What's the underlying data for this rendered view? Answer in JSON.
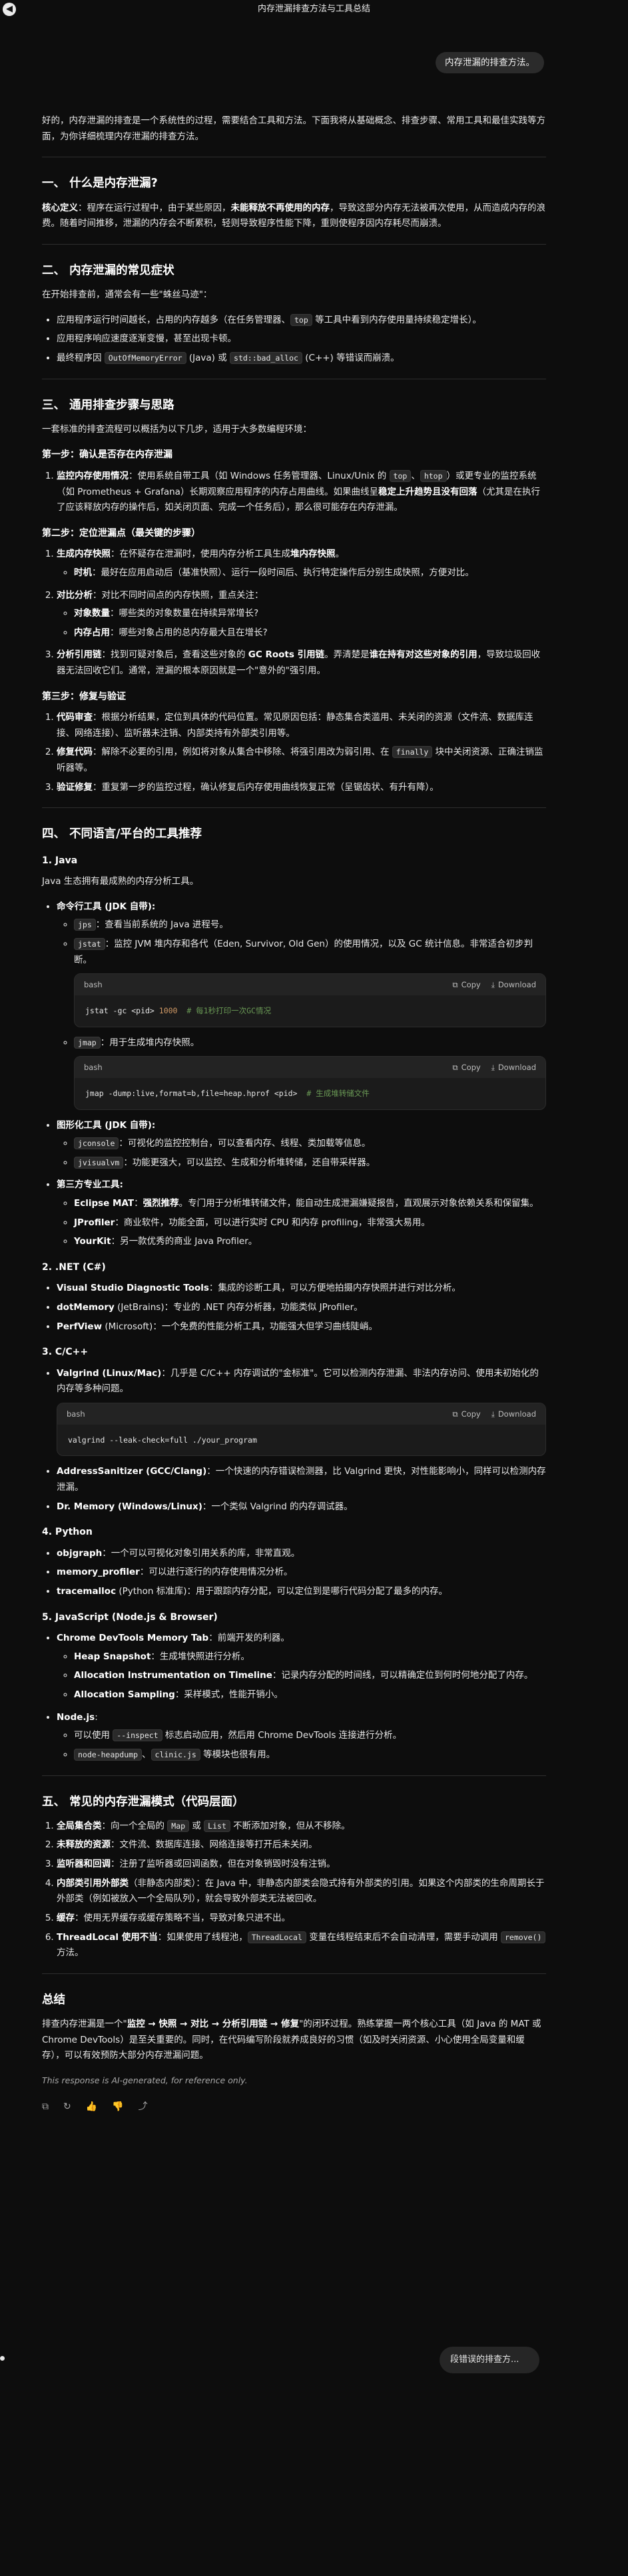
{
  "topbar": {
    "back_icon": "◀",
    "title": "内存泄漏排查方法与工具总结"
  },
  "user_message": "内存泄漏的排查方法。",
  "intro": "好的，内存泄漏的排查是一个系统性的过程，需要结合工具和方法。下面我将从基础概念、排查步骤、常用工具和最佳实践等方面，为你详细梳理内存泄漏的排查方法。",
  "s1": {
    "title": "一、 什么是内存泄漏?",
    "label": "核心定义",
    "text1": "：程序在运行过程中，由于某些原因，",
    "bold": "未能释放不再使用的内存",
    "text2": "，导致这部分内存无法被再次使用，从而造成内存的浪费。随着时间推移，泄漏的内存会不断累积，轻则导致程序性能下降，重则使程序因内存耗尽而崩溃。"
  },
  "s2": {
    "title": "二、 内存泄漏的常见症状",
    "lead": "在开始排查前，通常会有一些\"蛛丝马迹\"：",
    "b1a": "应用程序运行时间越长，占用的内存越多（在任务管理器、",
    "b1code": "top",
    "b1b": " 等工具中看到内存使用量持续稳定增长）。",
    "b2": "应用程序响应速度逐渐变慢，甚至出现卡顿。",
    "b3a": "最终程序因 ",
    "b3code1": "OutOfMemoryError",
    "b3b": " (Java) 或 ",
    "b3code2": "std::bad_alloc",
    "b3c": " (C++) 等错误而崩溃。"
  },
  "s3": {
    "title": "三、 通用排查步骤与思路",
    "lead": "一套标准的排查流程可以概括为以下几步，适用于大多数编程环境：",
    "step1": "第一步：确认是否存在内存泄漏",
    "s1_label": "监控内存使用情况",
    "s1_t1": "：使用系统自带工具（如 Windows 任务管理器、Linux/Unix 的 ",
    "s1_code1": "top",
    "s1_t2": "、",
    "s1_code2": "htop",
    "s1_t3": "）或更专业的监控系统（如 Prometheus + Grafana）长期观察应用程序的内存占用曲线。如果曲线呈",
    "s1_bold": "稳定上升趋势且没有回落",
    "s1_t4": "（尤其是在执行了应该释放内存的操作后，如关闭页面、完成一个任务后），那么很可能存在内存泄漏。",
    "step2": "第二步：定位泄漏点（最关键的步骤）",
    "s2a_label": "生成内存快照",
    "s2a_t1": "：在怀疑存在泄漏时，使用内存分析工具生成",
    "s2a_bold": "堆内存快照",
    "s2a_t2": "。",
    "s2a_sub_label": "时机",
    "s2a_sub_text": "：最好在应用启动后（基准快照）、运行一段时间后、执行特定操作后分别生成快照，方便对比。",
    "s2b_label": "对比分析",
    "s2b_text": "：对比不同时间点的内存快照，重点关注：",
    "s2b_sub1_label": "对象数量",
    "s2b_sub1_text": "：哪些类的对象数量在持续异常增长?",
    "s2b_sub2_label": "内存占用",
    "s2b_sub2_text": "：哪些对象占用的总内存最大且在增长?",
    "s2c_label": "分析引用链",
    "s2c_t1": "：找到可疑对象后，查看这些对象的 ",
    "s2c_bold1": "GC Roots 引用链",
    "s2c_t2": "。弄清楚是",
    "s2c_bold2": "谁在持有对这些对象的引用",
    "s2c_t3": "，导致垃圾回收器无法回收它们。通常，泄漏的根本原因就是一个\"意外的\"强引用。",
    "step3": "第三步：修复与验证",
    "s3a_label": "代码审查",
    "s3a_t1": "：根据分析结果，定位到具体的代码位置。常见原因包括：静态集合类滥用、未关闭的资源（文件流、数据库连接、网络连接）、监听器未注销、内部类持有外部类引用等。",
    "s3b_label": "修复代码",
    "s3b_t1": "：解除不必要的引用，例如将对象从集合中移除、将强引用改为弱引用、在 ",
    "s3b_code": "finally",
    "s3b_t2": " 块中关闭资源、正确注销监听器等。",
    "s3c_label": "验证修复",
    "s3c_t1": "：重复第一步的监控过程，确认修复后内存使用曲线恢复正常（呈锯齿状、有升有降）。"
  },
  "s4": {
    "title": "四、 不同语言/平台的工具推荐",
    "java_title": "1. Java",
    "java_lead": "Java 生态拥有最成熟的内存分析工具。",
    "jdk_label": "命令行工具 (JDK 自带):",
    "jps_code": "jps",
    "jps_text": "：查看当前系统的 Java 进程号。",
    "jstat_code": "jstat",
    "jstat_text": "：监控 JVM 堆内存和各代（Eden, Survivor, Old Gen）的使用情况，以及 GC 统计信息。非常适合初步判断。",
    "jmap_code": "jmap",
    "jmap_text": "：用于生成堆内存快照。",
    "gui_label": "图形化工具 (JDK 自带):",
    "jconsole_code": "jconsole",
    "jconsole_text": "：可视化的监控控制台，可以查看内存、线程、类加载等信息。",
    "jvisualvm_code": "jvisualvm",
    "jvisualvm_text": "：功能更强大，可以监控、生成和分析堆转储，还自带采样器。",
    "third_label": "第三方专业工具:",
    "mat_label": "Eclipse MAT",
    "mat_t1": "：",
    "mat_bold": "强烈推荐",
    "mat_t2": "。专门用于分析堆转储文件，能自动生成泄漏嫌疑报告，直观展示对象依赖关系和保留集。",
    "jprofiler_label": "JProfiler",
    "jprofiler_text": "：商业软件，功能全面，可以进行实时 CPU 和内存 profiling，非常强大易用。",
    "yourkit_label": "YourKit",
    "yourkit_text": "：另一款优秀的商业 Java Profiler。",
    "net_title": "2. .NET (C#)",
    "vs_label": "Visual Studio Diagnostic Tools",
    "vs_text": "：集成的诊断工具，可以方便地拍摄内存快照并进行对比分析。",
    "dotmemory_label": "dotMemory",
    "dotmemory_text": " (JetBrains)：专业的 .NET 内存分析器，功能类似 JProfiler。",
    "perfview_label": "PerfView",
    "perfview_text": " (Microsoft)：一个免费的性能分析工具，功能强大但学习曲线陡峭。",
    "cpp_title": "3. C/C++",
    "valgrind_label": "Valgrind (Linux/Mac)",
    "valgrind_text": "：几乎是 C/C++ 内存调试的\"金标准\"。它可以检测内存泄漏、非法内存访问、使用未初始化的内存等多种问题。",
    "asan_label": "AddressSanitizer (GCC/Clang)",
    "asan_text": "：一个快速的内存错误检测器，比 Valgrind 更快，对性能影响小，同样可以检测内存泄漏。",
    "drmemory_label": "Dr. Memory (Windows/Linux)",
    "drmemory_text": "：一个类似 Valgrind 的内存调试器。",
    "py_title": "4. Python",
    "objgraph_label": "objgraph",
    "objgraph_text": "：一个可以可视化对象引用关系的库，非常直观。",
    "memprof_label": "memory_profiler",
    "memprof_text": "：可以进行逐行的内存使用情况分析。",
    "tracemalloc_label": "tracemalloc",
    "tracemalloc_text": " (Python 标准库)：用于跟踪内存分配，可以定位到是哪行代码分配了最多的内存。",
    "js_title": "5. JavaScript (Node.js & Browser)",
    "devtools_label": "Chrome DevTools Memory Tab",
    "devtools_text": "：前端开发的利器。",
    "heap_label": "Heap Snapshot",
    "heap_text": "：生成堆快照进行分析。",
    "alloc_label": "Allocation Instrumentation on Timeline",
    "alloc_text": "：记录内存分配的时间线，可以精确定位到何时何地分配了内存。",
    "sampling_label": "Allocation Sampling",
    "sampling_text": "：采样模式，性能开销小。",
    "node_label": "Node.js",
    "node_text": ":",
    "node_sub1_t1": "可以使用 ",
    "node_sub1_code": "--inspect",
    "node_sub1_t2": " 标志启动应用，然后用 Chrome DevTools 连接进行分析。",
    "node_sub2_code1": "node-heapdump",
    "node_sub2_t1": "、",
    "node_sub2_code2": "clinic.js",
    "node_sub2_t2": " 等模块也很有用。"
  },
  "code_blocks": {
    "lang": "bash",
    "copy": "Copy",
    "download": "Download",
    "copy_icon": "⧉",
    "download_icon": "⤓",
    "jstat_cmd": "jstat -gc <pid> ",
    "jstat_num": "1000",
    "jstat_comment": "  # 每1秒打印一次GC情况",
    "jmap_cmd": "jmap -dump:live,format=b,file=heap.hprof <pid>",
    "jmap_comment": "  # 生成堆转储文件",
    "valgrind_cmd": "valgrind --leak-check=full ./your_program"
  },
  "s5": {
    "title": "五、 常见的内存泄漏模式（代码层面）",
    "i1_label": "全局集合类",
    "i1_t1": "：向一个全局的 ",
    "i1_code1": "Map",
    "i1_t2": " 或 ",
    "i1_code2": "List",
    "i1_t3": " 不断添加对象，但从不移除。",
    "i2_label": "未释放的资源",
    "i2_text": "：文件流、数据库连接、网络连接等打开后未关闭。",
    "i3_label": "监听器和回调",
    "i3_text": "：注册了监听器或回调函数，但在对象销毁时没有注销。",
    "i4_label": "内部类引用外部类",
    "i4_text": "（非静态内部类）：在 Java 中，非静态内部类会隐式持有外部类的引用。如果这个内部类的生命周期长于外部类（例如被放入一个全局队列），就会导致外部类无法被回收。",
    "i5_label": "缓存",
    "i5_text": "：使用无界缓存或缓存策略不当，导致对象只进不出。",
    "i6_label": "ThreadLocal 使用不当",
    "i6_t1": "：如果使用了线程池，",
    "i6_code1": "ThreadLocal",
    "i6_t2": " 变量在线程结束后不会自动清理，需要手动调用 ",
    "i6_code2": "remove()",
    "i6_t3": " 方法。"
  },
  "summary": {
    "title": "总结",
    "t1": "排查内存泄漏是一个\"",
    "bold": "监控 → 快照 → 对比 → 分析引用链 → 修复",
    "t2": "\"的闭环过程。熟练掌握一两个核心工具（如 Java 的 MAT 或 Chrome DevTools）是至关重要的。同时，在代码编写阶段就养成良好的习惯（如及时关闭资源、小心使用全局变量和缓存），可以有效预防大部分内存泄漏问题。"
  },
  "ai_note": "This response is AI-generated, for reference only.",
  "feedback_icons": {
    "copy": "⧉",
    "regenerate": "↻",
    "like": "👍",
    "dislike": "👎",
    "share": "⤴"
  },
  "bottom_input": "段错误的排查方..."
}
